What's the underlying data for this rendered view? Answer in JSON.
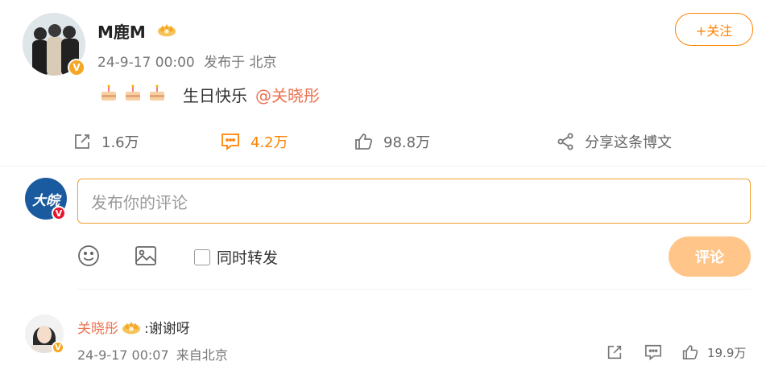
{
  "post": {
    "author": "M鹿M",
    "time": "24-9-17 00:00",
    "source": "发布于 北京",
    "text": "生日快乐",
    "mention": "@关晓彤",
    "follow_label": "+关注",
    "reposts": "1.6万",
    "comments": "4.2万",
    "likes": "98.8万",
    "share_label": "分享这条博文"
  },
  "composer": {
    "placeholder": "发布你的评论",
    "repost_label": "同时转发",
    "submit_label": "评论",
    "avatar_text": "大皖"
  },
  "comment": {
    "author": "关晓彤",
    "text": ":谢谢呀",
    "time": "24-9-17 00:07",
    "source": "来自北京",
    "likes": "19.9万"
  },
  "colors": {
    "accent": "#ff8200",
    "mention": "#eb7350",
    "submit_disabled": "#ffc589"
  }
}
